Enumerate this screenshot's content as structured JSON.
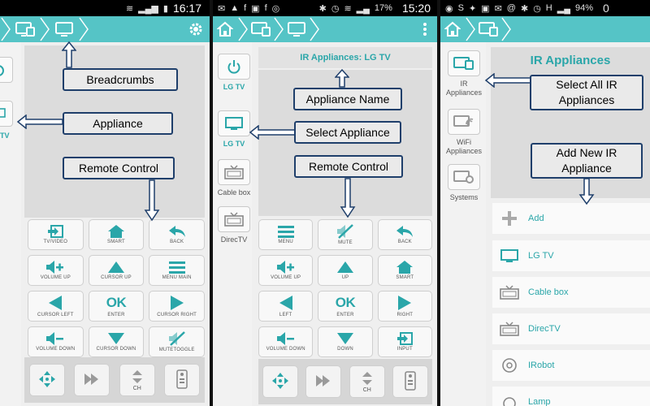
{
  "status_bars": [
    {
      "time": "16:17",
      "icons": [
        "wifi-icon",
        "signal-icon",
        "battery-icon"
      ]
    },
    {
      "time": "15:20",
      "battery": "17%",
      "icons": [
        "bluetooth-icon",
        "alarm-icon",
        "wifi-icon",
        "signal-icon"
      ]
    },
    {
      "battery": "94%",
      "time_partial": "0",
      "indicator": "H"
    }
  ],
  "screen1": {
    "side_label": "TV",
    "buttons": [
      {
        "label": "TV/VIDEO",
        "icon": "input-icon"
      },
      {
        "label": "SMART",
        "icon": "home-icon"
      },
      {
        "label": "BACK",
        "icon": "back-icon"
      },
      {
        "label": "VOLUME UP",
        "icon": "volume-up-icon"
      },
      {
        "label": "CURSOR UP",
        "icon": "up-icon"
      },
      {
        "label": "MENU MAIN",
        "icon": "menu-icon"
      },
      {
        "label": "CURSOR LEFT",
        "icon": "left-icon"
      },
      {
        "label": "ENTER",
        "icon": "ok-icon",
        "text": "OK"
      },
      {
        "label": "CURSOR RIGHT",
        "icon": "right-icon"
      },
      {
        "label": "VOLUME DOWN",
        "icon": "volume-down-icon"
      },
      {
        "label": "CURSOR DOWN",
        "icon": "down-icon"
      },
      {
        "label": "MUTETOGGLE",
        "icon": "mute-icon"
      }
    ],
    "bottom": [
      {
        "icon": "dpad-icon",
        "label": ""
      },
      {
        "icon": "media-icon",
        "label": ""
      },
      {
        "icon": "channel-icon",
        "label": "CH"
      },
      {
        "icon": "remote-icon",
        "label": ""
      }
    ],
    "callouts": {
      "breadcrumbs": "Breadcrumbs",
      "appliance": "Appliance",
      "remote": "Remote Control"
    }
  },
  "screen2": {
    "side": [
      {
        "label": "LG TV",
        "icon": "power-icon"
      },
      {
        "label": "LG TV",
        "icon": "tv-icon"
      },
      {
        "label": "Cable box",
        "icon": "cablebox-icon"
      },
      {
        "label": "DirecTV",
        "icon": "directv-icon"
      }
    ],
    "title": "IR Appliances: LG TV",
    "buttons": [
      {
        "label": "MENU",
        "icon": "menu-icon"
      },
      {
        "label": "MUTE",
        "icon": "mute-icon"
      },
      {
        "label": "BACK",
        "icon": "back-icon"
      },
      {
        "label": "VOLUME UP",
        "icon": "volume-up-icon"
      },
      {
        "label": "UP",
        "icon": "up-icon"
      },
      {
        "label": "SMART",
        "icon": "home-icon"
      },
      {
        "label": "LEFT",
        "icon": "left-icon"
      },
      {
        "label": "ENTER",
        "icon": "ok-icon",
        "text": "OK"
      },
      {
        "label": "RIGHT",
        "icon": "right-icon"
      },
      {
        "label": "VOLUME DOWN",
        "icon": "volume-down-icon"
      },
      {
        "label": "DOWN",
        "icon": "down-icon"
      },
      {
        "label": "INPUT",
        "icon": "input-icon"
      }
    ],
    "bottom": [
      {
        "icon": "dpad-icon",
        "label": ""
      },
      {
        "icon": "media-icon",
        "label": ""
      },
      {
        "icon": "channel-icon",
        "label": "CH"
      },
      {
        "icon": "remote-icon",
        "label": ""
      }
    ],
    "callouts": {
      "appliance_name": "Appliance Name",
      "select_appliance": "Select Appliance",
      "remote": "Remote Control"
    }
  },
  "screen3": {
    "side": [
      {
        "label": "IR\nAppliances",
        "icon": "ir-icon"
      },
      {
        "label": "WiFi\nAppliances",
        "icon": "wifi-appliance-icon"
      },
      {
        "label": "Systems",
        "icon": "systems-icon"
      }
    ],
    "title": "IR Appliances",
    "list": [
      {
        "label": "Add",
        "icon": "plus-icon"
      },
      {
        "label": "LG TV",
        "icon": "tv-icon"
      },
      {
        "label": "Cable box",
        "icon": "cablebox-icon"
      },
      {
        "label": "DirecTV",
        "icon": "directv-icon"
      },
      {
        "label": "IRobot",
        "icon": "irobot-icon"
      },
      {
        "label": "Lamp",
        "icon": "lamp-icon"
      }
    ],
    "callouts": {
      "select_all": "Select All IR\nAppliances",
      "add_new": "Add New IR\nAppliance"
    }
  },
  "colors": {
    "accent": "#55c4c6",
    "teal_text": "#2aa6a9",
    "callout_border": "#1f3f6b"
  }
}
